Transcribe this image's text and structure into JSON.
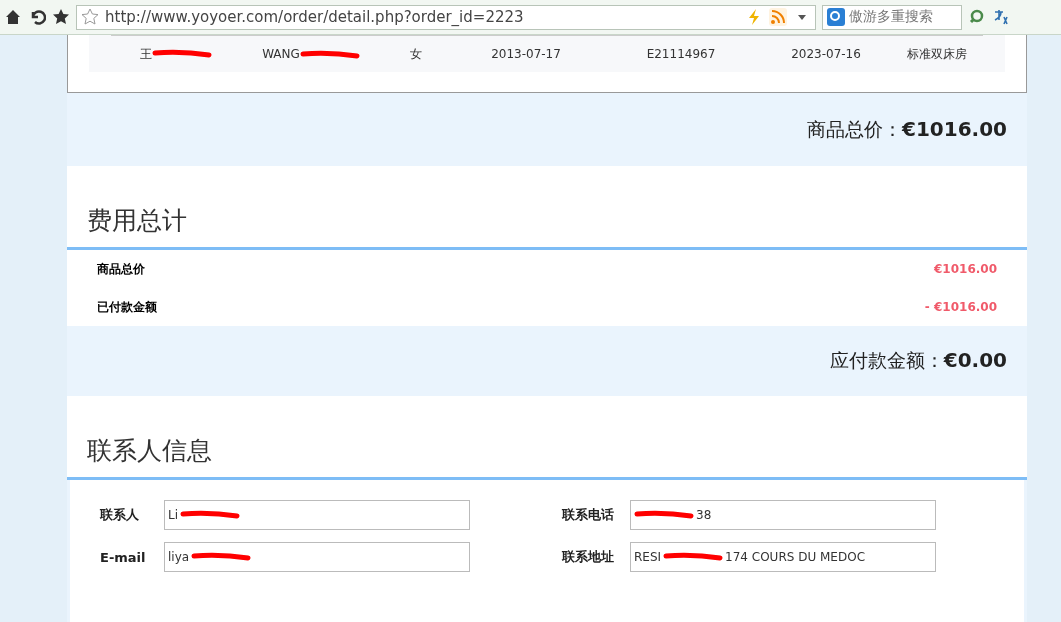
{
  "browser": {
    "url": "http://www.yoyoer.com/order/detail.php?order_id=2223",
    "search_placeholder": "傲游多重搜索"
  },
  "guest_row": [
    {
      "text": "王",
      "redacted": true
    },
    {
      "text": "WANG",
      "redacted": true
    },
    {
      "text": "女",
      "redacted": false
    },
    {
      "text": "2013-07-17",
      "redacted": false
    },
    {
      "text": "E21114967",
      "redacted": false
    },
    {
      "text": "2023-07-16",
      "redacted": false
    },
    {
      "text": "标准双床房",
      "redacted": false
    }
  ],
  "goods_total": {
    "label": "商品总价：",
    "amount": "€1016.00"
  },
  "fee_section": {
    "title": "费用总计",
    "rows": [
      {
        "label": "商品总价",
        "amount": "€1016.00"
      },
      {
        "label": "已付款金额",
        "amount": "- €1016.00"
      }
    ]
  },
  "amount_due": {
    "label": "应付款金额：",
    "amount": "€0.00"
  },
  "contact_section": {
    "title": "联系人信息",
    "fields": [
      {
        "label": "联系人",
        "value": "Li"
      },
      {
        "label": "联系电话",
        "value_after": "38"
      },
      {
        "label": "E-mail",
        "value": "liya"
      },
      {
        "label": "联系地址",
        "value": "RESI",
        "value_after": "174 COURS DU MEDOC"
      }
    ]
  }
}
